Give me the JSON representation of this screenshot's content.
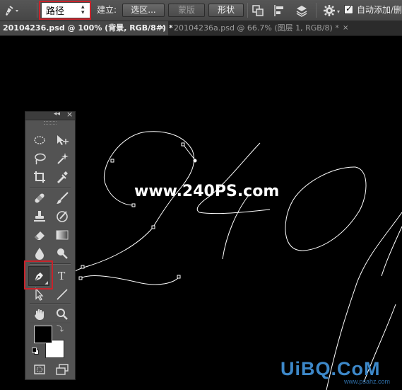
{
  "options_bar": {
    "tool_icon": "pen-tool-icon",
    "mode_select": "路径",
    "make_label": "建立:",
    "selection_button": "选区...",
    "mask_button": "蒙版",
    "shape_button": "形状",
    "path_ops_icon": "path-operations-icon",
    "path_align_icon": "path-alignment-icon",
    "path_arrange_icon": "path-arrangement-icon",
    "settings_icon": "gear-icon",
    "auto_add_checkbox": true,
    "auto_add_label": "自动添加/删"
  },
  "tabs": [
    {
      "label": "20104236.psd @ 100% (背景, RGB/8#) *",
      "active": true,
      "close": "×"
    },
    {
      "label": "20104236a.psd @ 66.7% (图层 1, RGB/8) *",
      "active": false,
      "close": "×"
    }
  ],
  "tools_panel": {
    "collapse": "◂◂",
    "close": "×",
    "tools": [
      "marquee-tool-icon",
      "move-tool-icon",
      "lasso-tool-icon",
      "magic-wand-tool-icon",
      "crop-tool-icon",
      "eyedropper-tool-icon",
      "healing-brush-tool-icon",
      "brush-tool-icon",
      "clone-stamp-tool-icon",
      "history-brush-tool-icon",
      "eraser-tool-icon",
      "gradient-tool-icon",
      "blur-tool-icon",
      "dodge-tool-icon",
      "pen-tool-icon",
      "type-tool-icon",
      "path-selection-tool-icon",
      "line-tool-icon",
      "hand-tool-icon",
      "zoom-tool-icon"
    ],
    "foreground_color": "#000000",
    "background_color": "#ffffff"
  },
  "canvas": {
    "watermark": "www.240PS.com",
    "logo": "UiBQ.CoM",
    "logo_sub": "www.psahz.com"
  },
  "colors": {
    "highlight": "#c8232b",
    "path": "#ffffff"
  }
}
